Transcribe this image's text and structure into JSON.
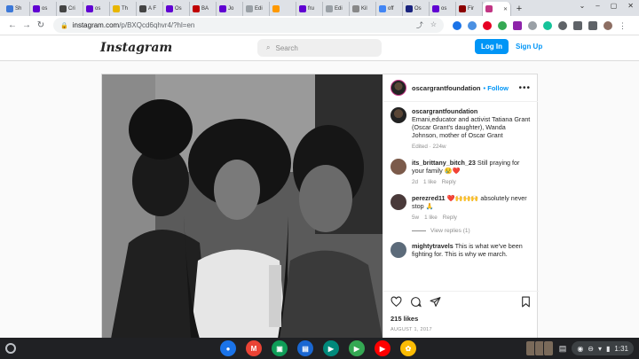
{
  "browser": {
    "tabs": [
      {
        "label": "Sh",
        "color": "#3c78d8"
      },
      {
        "label": "os",
        "color": "#6001d2"
      },
      {
        "label": "Cri",
        "color": "#444444"
      },
      {
        "label": "os",
        "color": "#6001d2"
      },
      {
        "label": "Th",
        "color": "#e8b600"
      },
      {
        "label": "A F",
        "color": "#444444"
      },
      {
        "label": "Os",
        "color": "#6001d2"
      },
      {
        "label": "BA",
        "color": "#c00000"
      },
      {
        "label": "Jo",
        "color": "#6001d2"
      },
      {
        "label": "Edi",
        "color": "#9aa0a6"
      },
      {
        "label": "",
        "color": "#ff9900"
      },
      {
        "label": "fru",
        "color": "#6001d2"
      },
      {
        "label": "Edi",
        "color": "#9aa0a6"
      },
      {
        "label": "Kil",
        "color": "#888888"
      },
      {
        "label": "off",
        "color": "#4285f4"
      },
      {
        "label": "Os",
        "color": "#1a237e"
      },
      {
        "label": "os",
        "color": "#6001d2"
      },
      {
        "label": "Fir",
        "color": "#8b0000"
      }
    ],
    "active_tab_color": "#c13584",
    "new_tab": "+",
    "url_host": "instagram.com",
    "url_path": "/p/BXQcd6qhvr4/?hl=en"
  },
  "instagram": {
    "logo": "Instagram",
    "search_placeholder": "Search",
    "login_label": "Log In",
    "signup_label": "Sign Up"
  },
  "post": {
    "username": "oscargrantfoundation",
    "follow_label": "Follow",
    "more": "•••",
    "caption_user": "oscargrantfoundation",
    "caption_text": "Emani,educator and activist Tatiana Grant (Oscar Grant's daughter), Wanda Johnson, mother of Oscar Grant",
    "caption_meta": "Edited · 224w",
    "comments": [
      {
        "user": "its_brittany_bitch_23",
        "text": "Still praying for your family 😢❤️",
        "age": "2d",
        "likes": "1 like",
        "reply": "Reply",
        "color": "#7b5a4a"
      },
      {
        "user": "perezred11",
        "text": "❤️🙌🙌🙌 absolutely never stop 🙏",
        "age": "5w",
        "likes": "1 like",
        "reply": "Reply",
        "color": "#4a3a3a"
      },
      {
        "user": "mightytravels",
        "text": "This is what we've been fighting for. This is why we march.",
        "color": "#5c6b7a"
      }
    ],
    "view_replies": "View replies (1)",
    "likes": "215 likes",
    "date": "AUGUST 1, 2017"
  },
  "shelf": {
    "time": "1:31",
    "apps": [
      {
        "name": "chrome",
        "color": "#1a73e8",
        "glyph": "●"
      },
      {
        "name": "gmail",
        "color": "#ea4335",
        "glyph": "M"
      },
      {
        "name": "classroom",
        "color": "#0f9d58",
        "glyph": "▣"
      },
      {
        "name": "files",
        "color": "#1967d2",
        "glyph": "▤"
      },
      {
        "name": "meet",
        "color": "#00897b",
        "glyph": "▶"
      },
      {
        "name": "play-store",
        "color": "#34a853",
        "glyph": "▶"
      },
      {
        "name": "youtube",
        "color": "#ff0000",
        "glyph": "▶"
      },
      {
        "name": "photos",
        "color": "#fbbc04",
        "glyph": "✿"
      }
    ]
  }
}
